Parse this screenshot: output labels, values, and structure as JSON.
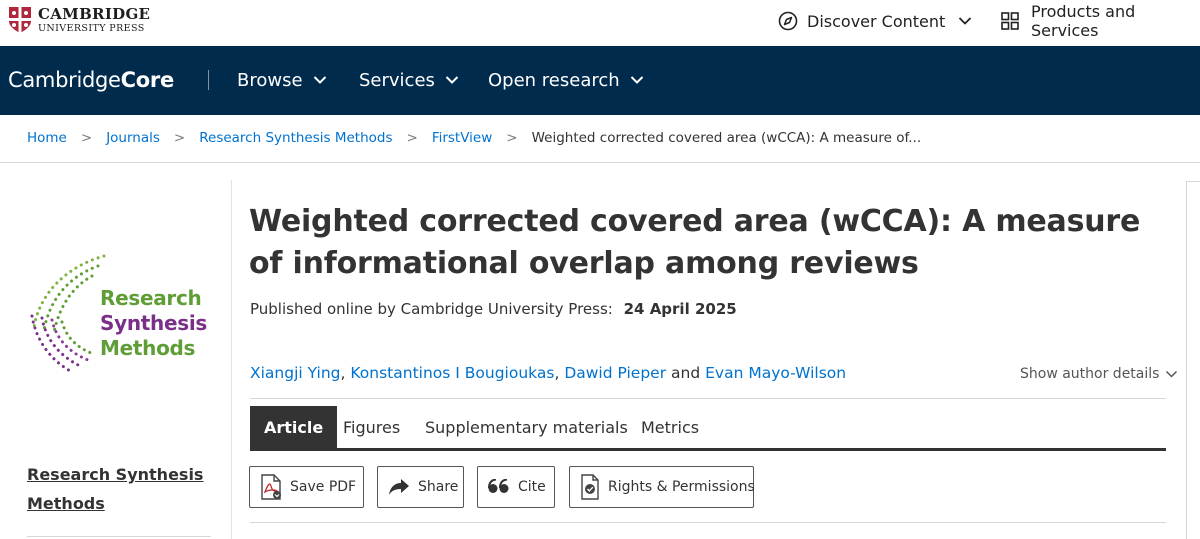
{
  "publisher": {
    "name_line1": "CAMBRIDGE",
    "name_line2": "UNIVERSITY PRESS"
  },
  "top_links": {
    "discover": "Discover Content",
    "products": "Products and Services"
  },
  "navbar": {
    "brand_light": "Cambridge",
    "brand_bold": "Core",
    "items": [
      "Browse",
      "Services",
      "Open research"
    ],
    "background": "#002b4c"
  },
  "breadcrumb": {
    "items": [
      "Home",
      "Journals",
      "Research Synthesis Methods",
      "FirstView"
    ],
    "current": "Weighted corrected covered area (wCCA): A measure of...",
    "separator": ">"
  },
  "journal": {
    "logo_line1": "Research",
    "logo_line2": "Synthesis",
    "logo_line3": "Methods",
    "sidebar_link": "Research Synthesis Methods",
    "green": "#5f9d36",
    "purple": "#7a2f89"
  },
  "article": {
    "title": "Weighted corrected covered area (wCCA): A measure of informational overlap among reviews",
    "published_label": "Published online by Cambridge University Press:",
    "published_date": "24 April 2025",
    "authors": [
      "Xiangji Ying",
      "Konstantinos I Bougioukas",
      "Dawid Pieper",
      "Evan Mayo-Wilson"
    ],
    "author_sep": ",",
    "author_and": "and",
    "show_details": "Show author details"
  },
  "tabs": [
    "Article",
    "Figures",
    "Supplementary materials",
    "Metrics"
  ],
  "actions": {
    "pdf": "Save PDF",
    "share": "Share",
    "cite": "Cite",
    "rights": "Rights & Permissions"
  },
  "icons": {
    "shield": "university-shield-icon",
    "compass": "compass-icon",
    "grid": "grid-icon",
    "chevron": "chevron-down-icon",
    "pdf": "pdf-file-icon",
    "share": "share-arrow-icon",
    "cite": "quote-icon",
    "rights": "document-check-icon"
  },
  "colors": {
    "link": "#0072cf",
    "text": "#333333"
  }
}
